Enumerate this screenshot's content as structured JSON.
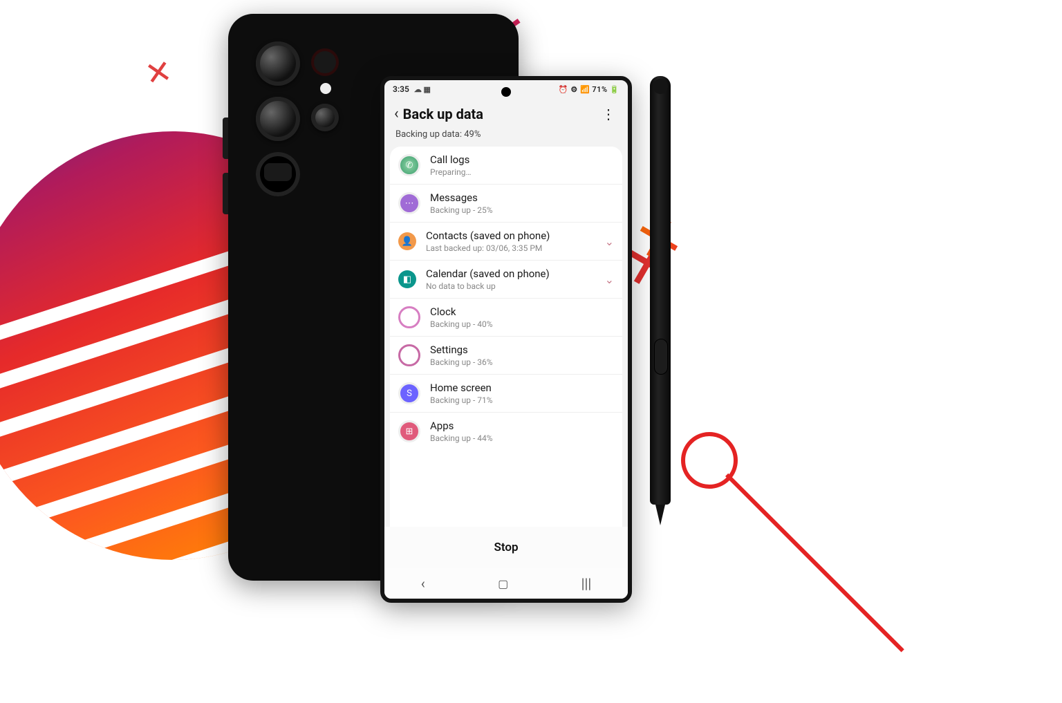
{
  "statusbar": {
    "time": "3:35",
    "left_icons": "☁ ▦",
    "right_icons": "⏰ ⚙ 📶 71% 🔋"
  },
  "header": {
    "title": "Back up data"
  },
  "progress": {
    "label": "Backing up data: 49%"
  },
  "items": [
    {
      "icon": "ic-call",
      "glyph": "✆",
      "title": "Call logs",
      "sub": "Preparing…",
      "expand": false
    },
    {
      "icon": "ic-msg",
      "glyph": "⋯",
      "title": "Messages",
      "sub": "Backing up - 25%",
      "expand": false
    },
    {
      "icon": "ic-contact",
      "glyph": "👤",
      "title": "Contacts (saved on phone)",
      "sub": "Last backed up: 03/06, 3:35 PM",
      "expand": true
    },
    {
      "icon": "ic-cal",
      "glyph": "◧",
      "title": "Calendar (saved on phone)",
      "sub": "No data to back up",
      "expand": true
    },
    {
      "icon": "ic-clock",
      "glyph": "◔",
      "title": "Clock",
      "sub": "Backing up - 40%",
      "expand": false
    },
    {
      "icon": "ic-set",
      "glyph": "⚙",
      "title": "Settings",
      "sub": "Backing up - 36%",
      "expand": false
    },
    {
      "icon": "ic-home",
      "glyph": "S",
      "title": "Home screen",
      "sub": "Backing up - 71%",
      "expand": false
    },
    {
      "icon": "ic-apps",
      "glyph": "⊞",
      "title": "Apps",
      "sub": "Backing up - 44%",
      "expand": false
    }
  ],
  "footer": {
    "stop": "Stop"
  }
}
